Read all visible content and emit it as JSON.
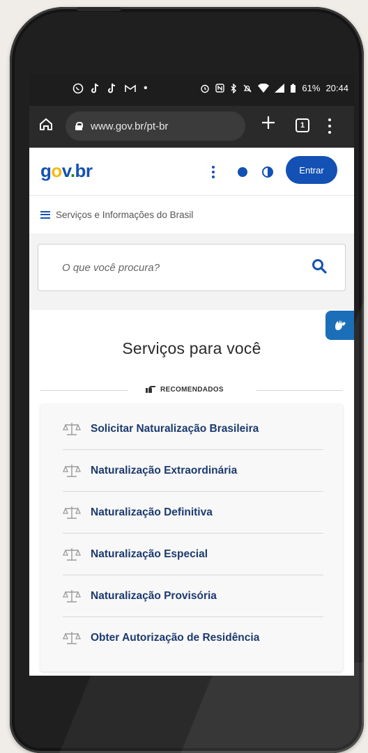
{
  "status_bar": {
    "left_icons": [
      "whatsapp-icon",
      "tiktok-icon",
      "tiktok-icon",
      "gmail-icon",
      "dot"
    ],
    "right_icons": [
      "alarm-icon",
      "nfc-icon",
      "bluetooth-icon",
      "mute-icon",
      "wifi-icon",
      "signal-icon",
      "battery-icon"
    ],
    "battery": "61%",
    "time": "20:44"
  },
  "browser": {
    "url": "www.gov.br/pt-br",
    "tab_count": "1"
  },
  "gov": {
    "logo": {
      "g": "g",
      "o": "o",
      "v": "v",
      "dot": ".",
      "br": "br"
    },
    "login_label": "Entrar",
    "menu_label": "Serviços e Informações do Brasil",
    "search_placeholder": "O que você procura?"
  },
  "services": {
    "title": "Serviços para você",
    "recommended_label": "RECOMENDADOS",
    "items": [
      {
        "label": "Solicitar Naturalização Brasileira"
      },
      {
        "label": "Naturalização Extraordinária"
      },
      {
        "label": "Naturalização Definitiva"
      },
      {
        "label": "Naturalização Especial"
      },
      {
        "label": "Naturalização Provisória"
      },
      {
        "label": "Obter Autorização de Residência"
      }
    ]
  },
  "colors": {
    "gov_blue": "#1351b4",
    "gov_yellow": "#f6b90d",
    "gov_green": "#168821",
    "service_text": "#1c3a6e"
  }
}
